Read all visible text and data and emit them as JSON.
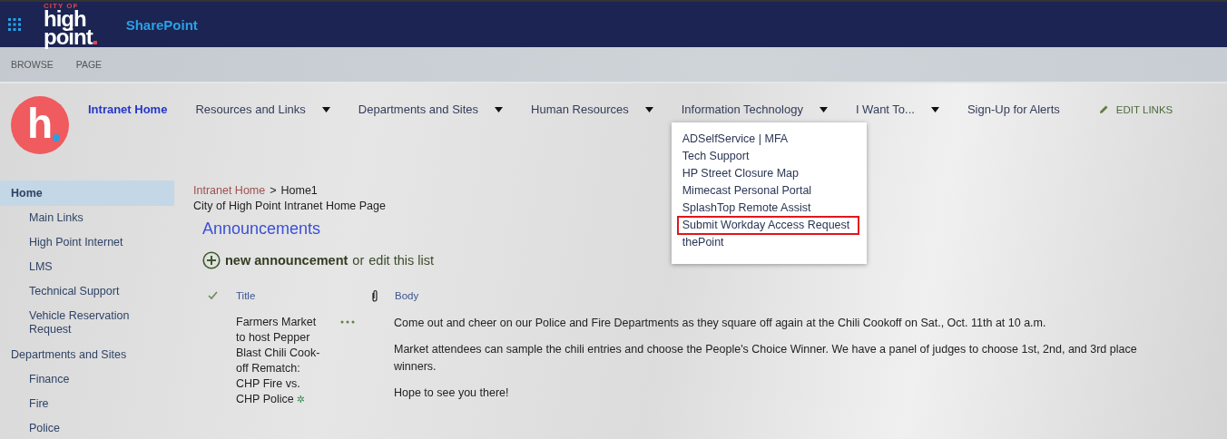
{
  "app_bar": {
    "logo": {
      "small": "CITY OF",
      "line1": "high",
      "line2": "point"
    },
    "app_name": "SharePoint"
  },
  "ribbon_tabs": [
    {
      "label": "BROWSE"
    },
    {
      "label": "PAGE"
    }
  ],
  "site_logo": {
    "letter": "h"
  },
  "top_nav": {
    "items": [
      {
        "label": "Intranet Home",
        "selected": true,
        "has_menu": false
      },
      {
        "label": "Resources and Links",
        "selected": false,
        "has_menu": true
      },
      {
        "label": "Departments and Sites",
        "selected": false,
        "has_menu": true
      },
      {
        "label": "Human Resources",
        "selected": false,
        "has_menu": true
      },
      {
        "label": "Information Technology",
        "selected": false,
        "has_menu": true,
        "menu": [
          {
            "label": "ADSelfService | MFA",
            "highlighted": false
          },
          {
            "label": "Tech Support",
            "highlighted": false
          },
          {
            "label": "HP Street Closure Map",
            "highlighted": false
          },
          {
            "label": "Mimecast Personal Portal",
            "highlighted": false
          },
          {
            "label": "SplashTop Remote Assist",
            "highlighted": false
          },
          {
            "label": "Submit Workday Access Request",
            "highlighted": true
          },
          {
            "label": "thePoint",
            "highlighted": false
          }
        ]
      },
      {
        "label": "I Want To...",
        "selected": false,
        "has_menu": true
      },
      {
        "label": "Sign-Up for Alerts",
        "selected": false,
        "has_menu": false
      }
    ],
    "edit_links": "EDIT LINKS"
  },
  "sidebar": {
    "items": [
      {
        "label": "Home",
        "selected": true,
        "children": [
          {
            "label": "Main Links",
            "selected": false
          },
          {
            "label": "High Point Internet",
            "selected": false
          },
          {
            "label": "LMS",
            "selected": false
          },
          {
            "label": "Technical Support",
            "selected": false
          },
          {
            "label": "Vehicle Reservation Request",
            "selected": false
          }
        ]
      },
      {
        "label": "Departments and Sites",
        "selected": false,
        "children": [
          {
            "label": "Finance",
            "selected": false
          },
          {
            "label": "Fire",
            "selected": false
          },
          {
            "label": "Police",
            "selected": false
          }
        ]
      }
    ]
  },
  "breadcrumb": {
    "items": [
      "Intranet Home",
      "Home1"
    ],
    "separator": ">"
  },
  "page_title": "City of High Point Intranet Home Page",
  "announcements": {
    "title": "Announcements",
    "new_link": "new announcement",
    "or_text": "or",
    "edit_link": "edit this list",
    "columns": {
      "title": "Title",
      "body": "Body"
    },
    "rows": [
      {
        "title": "Farmers Market to host Pepper Blast Chili Cook-off Rematch: CHP Fire vs. CHP Police",
        "new_marker": "✲",
        "body": [
          "Come out and cheer on our Police and Fire Departments as they square off again at the Chili Cookoff on Sat., Oct. 11th at 10 a.m.",
          "Market attendees can sample the chili entries and choose the People's Choice Winner. We have a panel of judges to choose 1st, 2nd, and 3rd place winners.",
          "Hope to see you there!"
        ]
      }
    ]
  }
}
